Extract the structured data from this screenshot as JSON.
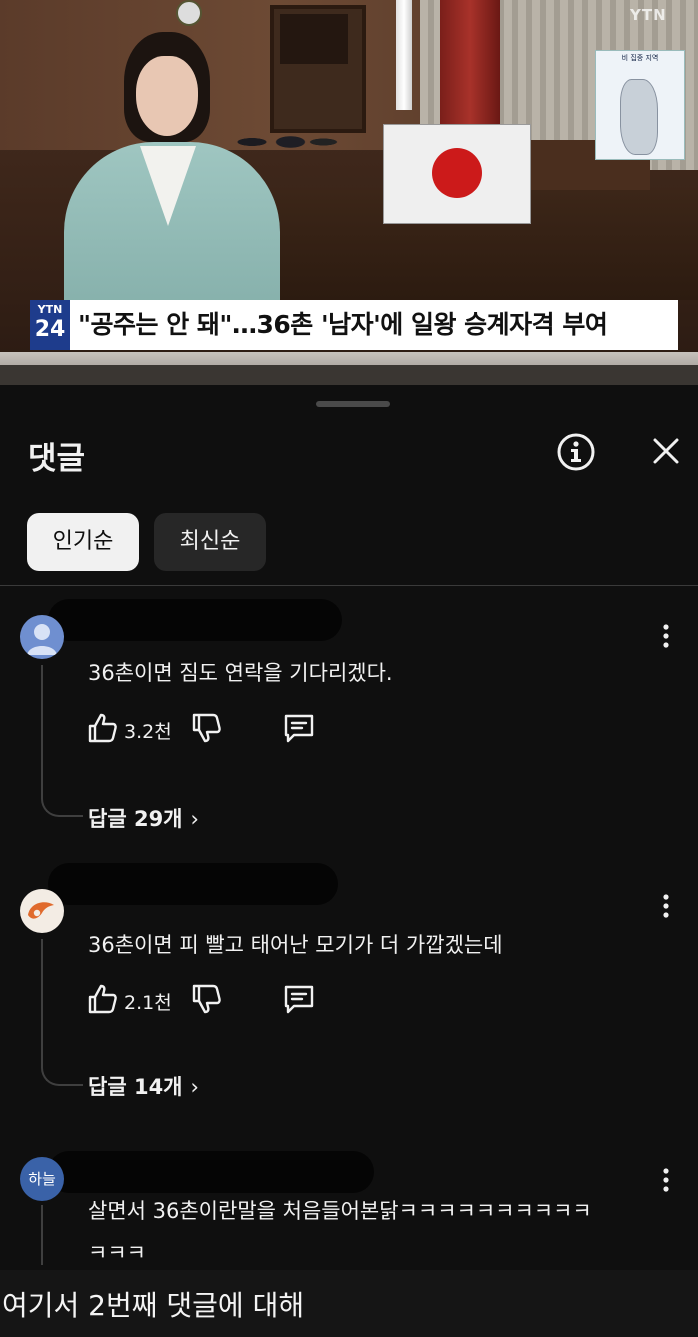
{
  "video": {
    "channel_logo": "YTN",
    "badge_top": "YTN",
    "badge_bottom": "24",
    "headline": "\"공주는 안 돼\"…36촌 '남자'에 일왕 승계자격 부여",
    "map_title": "비 집중 지역"
  },
  "comments_panel": {
    "title": "댓글",
    "info_icon": "info-icon",
    "close_icon": "close-icon",
    "sort_tabs": [
      {
        "label": "인기순",
        "active": true
      },
      {
        "label": "최신순",
        "active": false
      }
    ],
    "comments": [
      {
        "avatar": "default-user-icon",
        "text": "36촌이면 짐도 연락을 기다리겠다.",
        "likes": "3.2천",
        "replies": "답글 29개"
      },
      {
        "avatar": "orange-logo-avatar",
        "text": "36촌이면 피 빨고 태어난 모기가 더 가깝겠는데",
        "likes": "2.1천",
        "replies": "답글 14개"
      },
      {
        "avatar_text": "하늘",
        "text_line1": "살면서 36촌이란말을 처음들어본닭ㅋㅋㅋㅋㅋㅋㅋㅋㅋㅋ",
        "text_line2": "ㅋㅋㅋ"
      }
    ]
  },
  "caption": "여기서 2번째 댓글에 대해",
  "colors": {
    "background": "#0f0f0f",
    "text": "#f1f1f1",
    "chip_inactive": "#272727",
    "ytn_blue": "#1e3c8c",
    "avatar_blue": "#6f8fd0",
    "avatar_sky": "#3a62a8"
  }
}
